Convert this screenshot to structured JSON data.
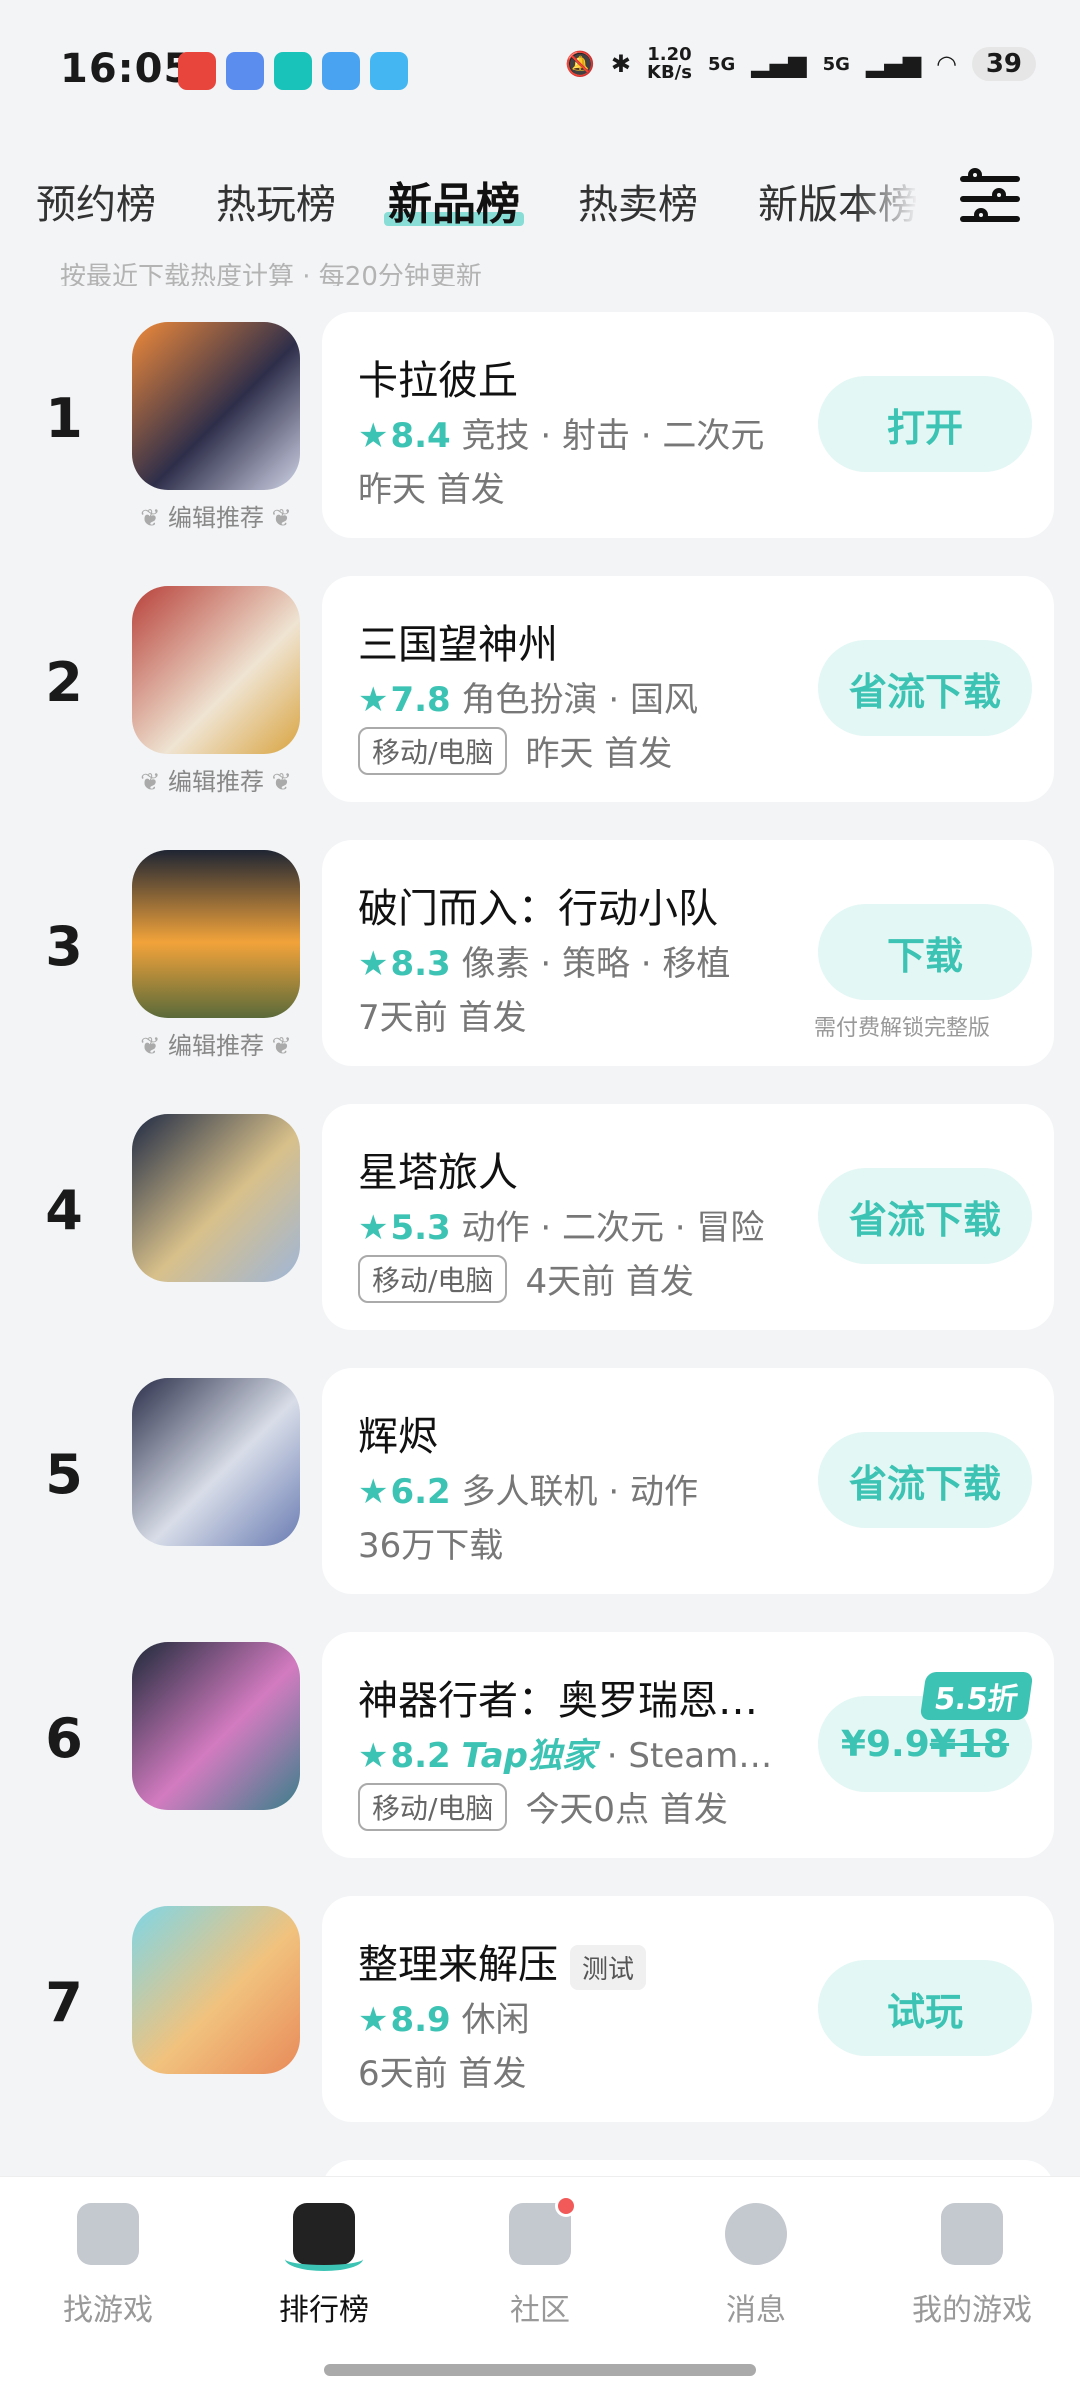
{
  "status_bar": {
    "time": "16:05",
    "net_speed_value": "1.20",
    "net_speed_unit": "KB/s",
    "sig1": "5G",
    "sig2": "5G",
    "battery": "39",
    "notif_colors": [
      "#e8453c",
      "#5b8def",
      "#19c3b9",
      "#4aa3f0",
      "#44b7f2"
    ]
  },
  "tabs": [
    "预约榜",
    "热玩榜",
    "新品榜",
    "热卖榜",
    "新版本榜"
  ],
  "active_tab": "新品榜",
  "hint": "按最近下载热度计算 · 每20分钟更新",
  "games": [
    {
      "rank": "1",
      "name": "卡拉彼丘",
      "score": "8.4",
      "genres": "竞技 · 射击 · 二次元",
      "sub": "昨天 首发",
      "action": "打开",
      "editor": "编辑推荐",
      "icon_colors": [
        "#f08a3a",
        "#2e2e4a",
        "#cfd3e6"
      ]
    },
    {
      "rank": "2",
      "name": "三国望神州",
      "score": "7.8",
      "genres": "角色扮演 · 国风",
      "device": "移动/电脑",
      "sub": "昨天 首发",
      "action": "省流下载",
      "editor": "编辑推荐",
      "icon_colors": [
        "#b8413a",
        "#efe4d2",
        "#d9a441"
      ]
    },
    {
      "rank": "3",
      "name": "破门而入：行动小队",
      "score": "8.3",
      "genres": "像素 · 策略 · 移植",
      "sub": "7天前 首发",
      "action": "下载",
      "action_note": "需付费解锁完整版",
      "editor": "编辑推荐",
      "icon_colors": [
        "#1f2533",
        "#f2a33a",
        "#5a6a3a"
      ]
    },
    {
      "rank": "4",
      "name": "星塔旅人",
      "score": "5.3",
      "genres": "动作 · 二次元 · 冒险",
      "device": "移动/电脑",
      "sub": "4天前 首发",
      "action": "省流下载",
      "icon_colors": [
        "#1f2a44",
        "#d8c08a",
        "#9fb6d8"
      ]
    },
    {
      "rank": "5",
      "name": "辉烬",
      "score": "6.2",
      "genres": "多人联机 · 动作",
      "sub": "36万下载",
      "action": "省流下载",
      "icon_colors": [
        "#2b2f4a",
        "#d8dde8",
        "#6a7cb3"
      ]
    },
    {
      "rank": "6",
      "name": "神器行者：奥罗瑞恩…",
      "score": "8.2",
      "tap_exclusive": "Tap独家",
      "genres": "· Steam…",
      "device": "移动/电脑",
      "sub": "今天0点 首发",
      "price": "¥9.9",
      "old_price": "¥18",
      "discount": "5.5折",
      "icon_colors": [
        "#1e2a3a",
        "#d37bc0",
        "#3b7f8a"
      ]
    },
    {
      "rank": "7",
      "name": "整理来解压",
      "test_tag": "测试",
      "score": "8.9",
      "genres": "休闲",
      "sub": "6天前 首发",
      "action": "试玩",
      "icon_colors": [
        "#7fd6e6",
        "#f1c27d",
        "#e88a5a"
      ]
    }
  ],
  "bottom_nav": [
    {
      "label": "找游戏",
      "icon": "find-game-icon"
    },
    {
      "label": "排行榜",
      "icon": "ranking-icon",
      "active": true
    },
    {
      "label": "社区",
      "icon": "community-icon",
      "badge": true
    },
    {
      "label": "消息",
      "icon": "message-icon"
    },
    {
      "label": "我的游戏",
      "icon": "my-games-icon"
    }
  ],
  "accent_color": "#3cc3b3"
}
